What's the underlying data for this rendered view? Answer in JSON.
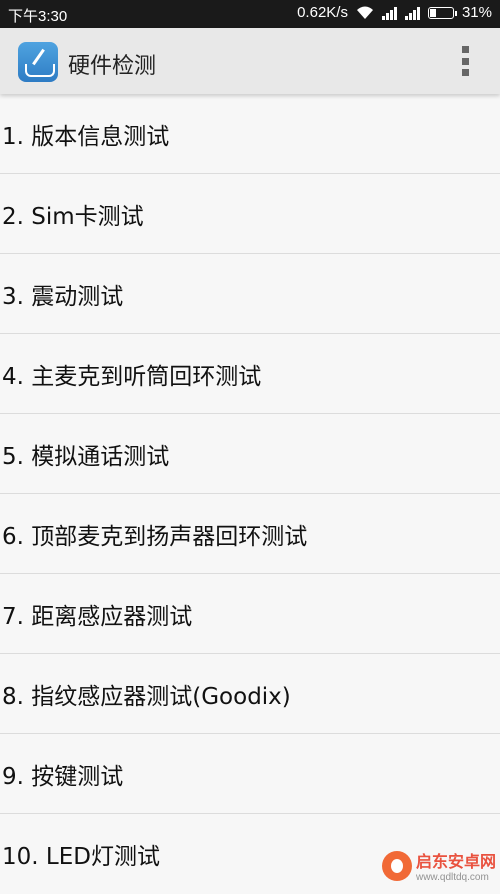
{
  "status_bar": {
    "time": "下午3:30",
    "net_speed": "0.62K/s",
    "battery": "31%",
    "battery_level": 0.31
  },
  "app_bar": {
    "title": "硬件检测",
    "icon": "toolbox-icon",
    "menu_icon": "overflow-menu-icon"
  },
  "items": [
    {
      "label": "1. 版本信息测试"
    },
    {
      "label": "2. Sim卡测试"
    },
    {
      "label": "3. 震动测试"
    },
    {
      "label": "4. 主麦克到听筒回环测试"
    },
    {
      "label": "5. 模拟通话测试"
    },
    {
      "label": "6. 顶部麦克到扬声器回环测试"
    },
    {
      "label": "7. 距离感应器测试"
    },
    {
      "label": "8. 指纹感应器测试(Goodix)"
    },
    {
      "label": "9. 按键测试"
    },
    {
      "label": "10. LED灯测试"
    }
  ],
  "watermark": {
    "text": "启东安卓网",
    "url": "www.qdltdq.com"
  }
}
